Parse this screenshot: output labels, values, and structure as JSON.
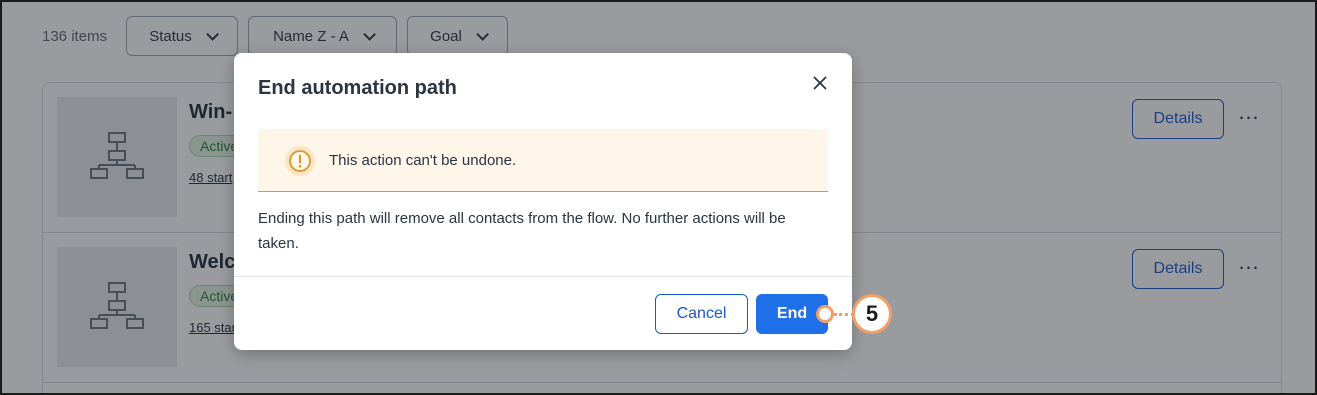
{
  "toolbar": {
    "items_count": "136 items",
    "filters": [
      {
        "label": "Status"
      },
      {
        "label": "Name Z - A"
      },
      {
        "label": "Goal"
      }
    ]
  },
  "rows": [
    {
      "title": "Win-",
      "status": "Active",
      "starts": "48 start",
      "details_label": "Details",
      "more_label": "…"
    },
    {
      "title": "Welc",
      "status": "Active",
      "starts": "165 star",
      "details_label": "Details",
      "more_label": "…"
    }
  ],
  "modal": {
    "title": "End automation path",
    "warning": "This action can't be undone.",
    "body": "Ending this path will remove all contacts from the flow. No further actions will be taken.",
    "cancel_label": "Cancel",
    "end_label": "End"
  },
  "callout": {
    "step": "5"
  },
  "colors": {
    "primary": "#1f6fe8",
    "outline_blue": "#1858c9",
    "warning_bg": "#fff6ea",
    "warning_accent": "#d79a2b",
    "callout_orange": "#f0a067",
    "active_badge_bg": "#e3f4e6"
  },
  "icons": {
    "filter_chevron": "chevron-down-icon",
    "thumbnail": "flowchart-icon",
    "warning": "warning-circle-icon",
    "close": "close-icon",
    "more": "more-horizontal-icon"
  }
}
